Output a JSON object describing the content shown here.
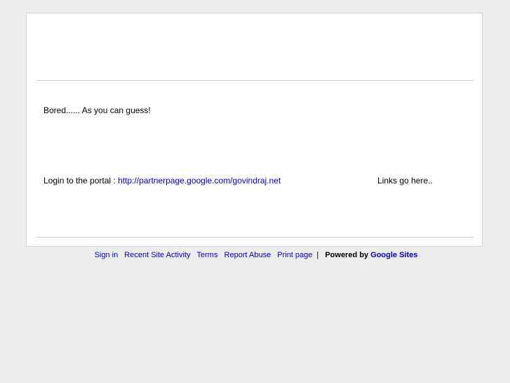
{
  "content": {
    "intro_text": "Bored...... As you can guess!",
    "login_prefix": "Login to the portal : ",
    "portal_link": "http://partnerpage.google.com/govindraj.net",
    "links_text": "Links go here.."
  },
  "footer": {
    "sign_in": "Sign in",
    "recent_activity": "Recent Site Activity",
    "terms": "Terms",
    "report_abuse": "Report Abuse",
    "print_page": "Print page",
    "separator": "|",
    "powered_by": "Powered by",
    "brand": "Google Sites"
  },
  "colors": {
    "background": "#ececec",
    "panel": "#ffffff",
    "link": "#0000cc"
  }
}
